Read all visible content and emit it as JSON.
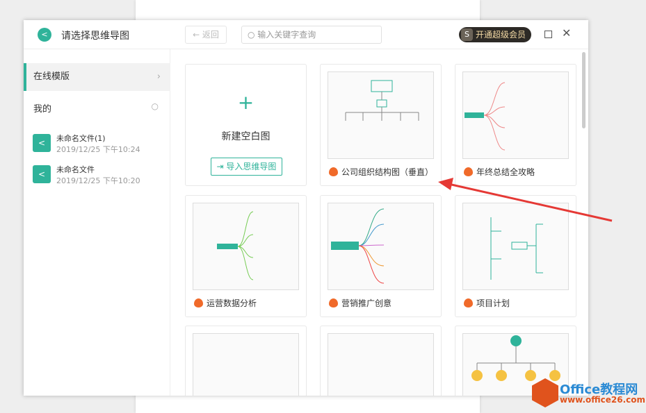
{
  "header": {
    "title": "请选择思维导图",
    "back_label": "← 返回",
    "search_placeholder": "输入关键字查询",
    "vip_label": "开通超级会员"
  },
  "sidebar": {
    "online": "在线模版",
    "mine": "我的",
    "files": [
      {
        "name": "未命名文件(1)",
        "date": "2019/12/25 下午10:24"
      },
      {
        "name": "未命名文件",
        "date": "2019/12/25 下午10:20"
      }
    ]
  },
  "new_card": {
    "label": "新建空白图",
    "import_label": "导入思维导图"
  },
  "templates": [
    {
      "name": "公司组织结构图（垂直）"
    },
    {
      "name": "年终总结全攻略"
    },
    {
      "name": "运营数据分析"
    },
    {
      "name": "营销推广创意"
    },
    {
      "name": "项目计划"
    }
  ],
  "watermark": {
    "line1": "Office教程网",
    "line2": "www.office26.com"
  },
  "colors": {
    "accent": "#2fb39a",
    "arrow": "#e53935"
  }
}
